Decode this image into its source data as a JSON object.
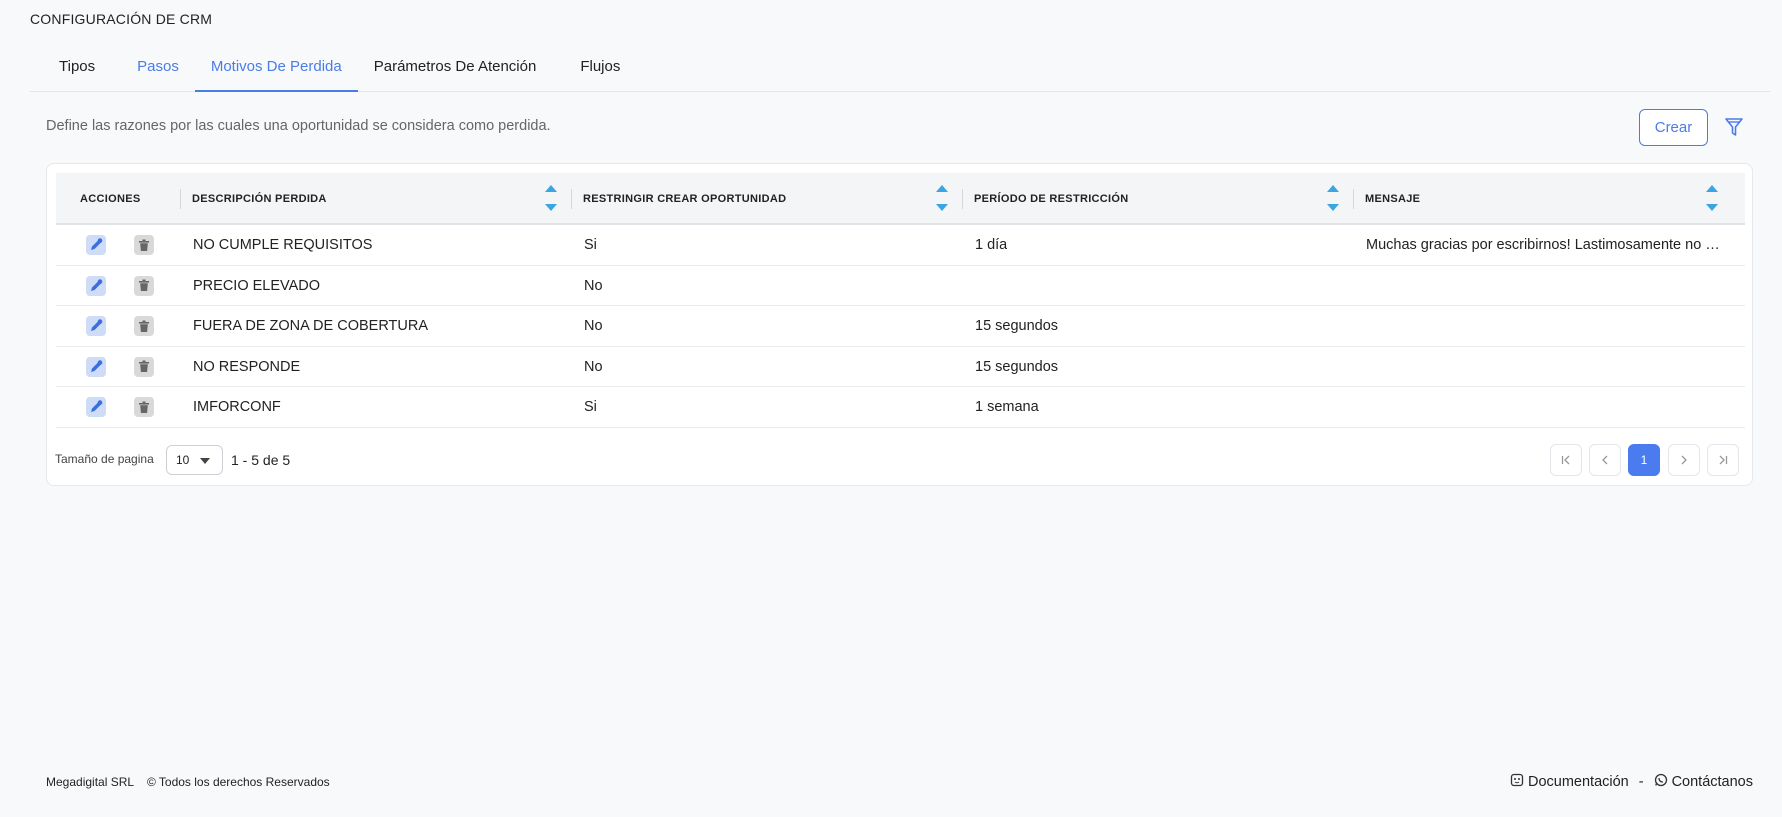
{
  "page": {
    "title": "CONFIGURACIÓN DE CRM",
    "description": "Define las razones por las cuales una oportunidad se considera como perdida."
  },
  "tabs": [
    {
      "label": "Tipos",
      "state": "default"
    },
    {
      "label": "Pasos",
      "state": "link"
    },
    {
      "label": "Motivos De Perdida",
      "state": "active"
    },
    {
      "label": "Parámetros De Atención",
      "state": "default"
    },
    {
      "label": "Flujos",
      "state": "default"
    }
  ],
  "toolbar": {
    "create_label": "Crear",
    "filter_icon": "filter-icon"
  },
  "table": {
    "headers": {
      "actions": "ACCIONES",
      "description": "DESCRIPCIÓN PERDIDA",
      "restrict": "RESTRINGIR CREAR OPORTUNIDAD",
      "period": "PERÍODO DE RESTRICCIÓN",
      "message": "MENSAJE"
    },
    "rows": [
      {
        "description": "NO CUMPLE REQUISITOS",
        "restrict": "Si",
        "period": "1 día",
        "message": "Muchas gracias por escribirnos! Lastimosamente no …"
      },
      {
        "description": "PRECIO ELEVADO",
        "restrict": "No",
        "period": "",
        "message": ""
      },
      {
        "description": "FUERA DE ZONA DE COBERTURA",
        "restrict": "No",
        "period": "15 segundos",
        "message": ""
      },
      {
        "description": "NO RESPONDE",
        "restrict": "No",
        "period": "15 segundos",
        "message": ""
      },
      {
        "description": "IMFORCONF",
        "restrict": "Si",
        "period": "1 semana",
        "message": ""
      }
    ],
    "row_icons": {
      "edit": "edit-icon",
      "delete": "trash-icon"
    }
  },
  "pagination": {
    "page_size_label": "Tamaño de pagina",
    "page_size": "10",
    "range": "1 - 5 de 5",
    "current_page": "1"
  },
  "footer": {
    "company": "Megadigital SRL",
    "copyright": "© Todos los derechos Reservados",
    "docs": "Documentación",
    "separator": "-",
    "contact": "Contáctanos"
  },
  "colors": {
    "accent": "#4a7ce8",
    "sort_arrow": "#3aa5e0",
    "background": "#f8f9fb"
  }
}
